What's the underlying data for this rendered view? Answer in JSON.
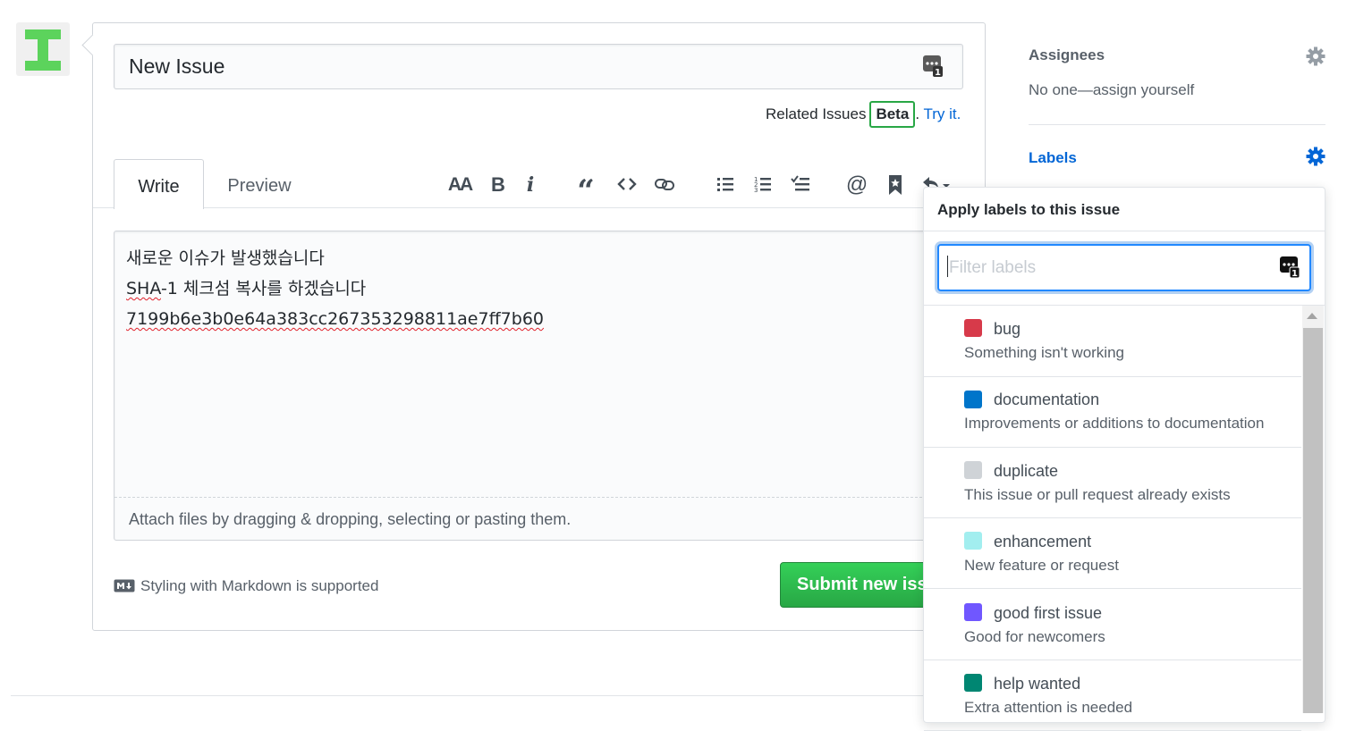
{
  "issue": {
    "title_value": "New Issue",
    "related_label": "Related Issues",
    "beta_badge": "Beta",
    "period": ".",
    "try_it_link": "Try it."
  },
  "tabs": {
    "write": "Write",
    "preview": "Preview"
  },
  "toolbar": {
    "heading_label": "AA",
    "bold_label": "B",
    "italic_label": "i",
    "quote_label": "“",
    "mention_label": "@"
  },
  "body": {
    "lines": [
      "새로운 이슈가 발생했습니다",
      "SHA-1 체크섬 복사를 하겠습니다",
      "7199b6e3b0e64a383cc267353298811ae7ff7b60"
    ],
    "line2_prefix": "SHA",
    "line2_rest": "-1 체크섬 복사를 하겠습니다",
    "attach_hint": "Attach files by dragging & dropping, selecting or pasting them."
  },
  "footer": {
    "markdown_note": "Styling with Markdown is supported",
    "submit_label": "Submit new issue"
  },
  "sidebar": {
    "assignees_heading": "Assignees",
    "assignees_value": "No one—assign yourself",
    "labels_heading": "Labels"
  },
  "labels_menu": {
    "title": "Apply labels to this issue",
    "filter_placeholder": "Filter labels",
    "items": [
      {
        "name": "bug",
        "description": "Something isn't working",
        "color": "#d73a4a"
      },
      {
        "name": "documentation",
        "description": "Improvements or additions to documentation",
        "color": "#0075ca"
      },
      {
        "name": "duplicate",
        "description": "This issue or pull request already exists",
        "color": "#cfd3d7"
      },
      {
        "name": "enhancement",
        "description": "New feature or request",
        "color": "#a2eeef"
      },
      {
        "name": "good first issue",
        "description": "Good for newcomers",
        "color": "#7057ff"
      },
      {
        "name": "help wanted",
        "description": "Extra attention is needed",
        "color": "#008672"
      }
    ]
  },
  "colors": {
    "accent": "#0366d6",
    "submit_green": "#2ea44f",
    "avatar_green": "#5cd35c"
  }
}
